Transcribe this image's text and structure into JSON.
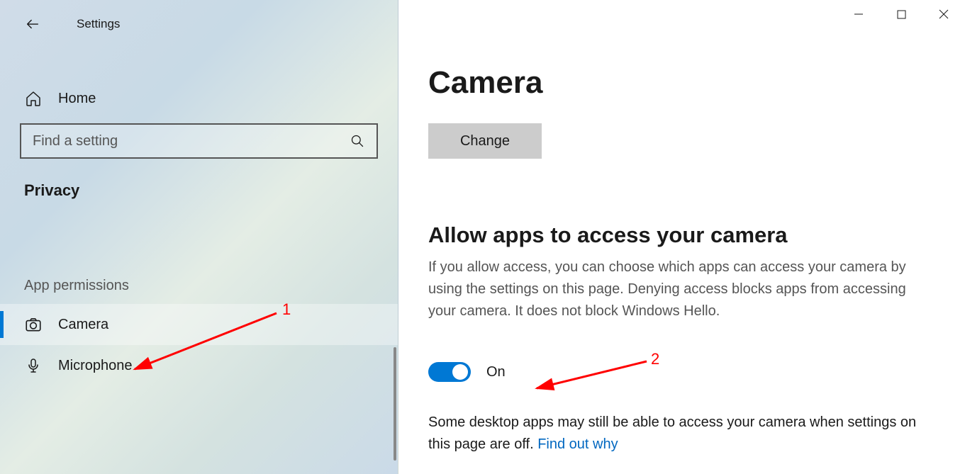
{
  "sidebar": {
    "title": "Settings",
    "home_label": "Home",
    "search_placeholder": "Find a setting",
    "section_label": "Privacy",
    "group_label": "App permissions",
    "items": {
      "camera": "Camera",
      "microphone": "Microphone"
    }
  },
  "main": {
    "title": "Camera",
    "change_label": "Change",
    "allow_heading": "Allow apps to access your camera",
    "allow_desc": "If you allow access, you can choose which apps can access your camera by using the settings on this page. Denying access blocks apps from accessing your camera. It does not block Windows Hello.",
    "toggle_state": "On",
    "note_text": "Some desktop apps may still be able to access your camera when settings on this page are off. ",
    "note_link": "Find out why"
  },
  "annotations": {
    "a1": "1",
    "a2": "2"
  }
}
